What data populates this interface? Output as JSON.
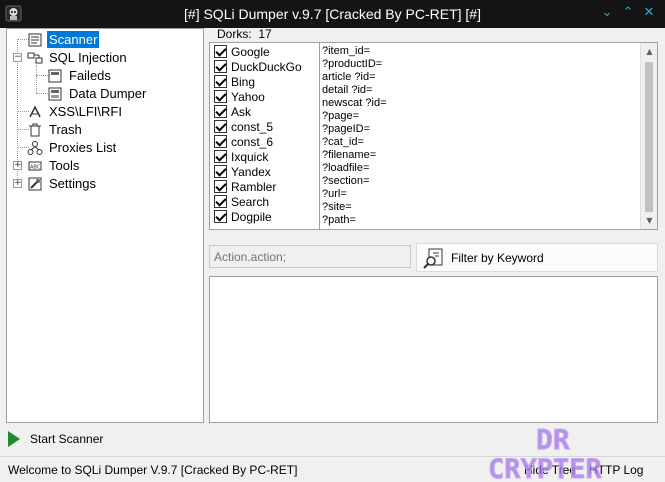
{
  "window": {
    "title": "[#] SQLi Dumper v.9.7 [Cracked By PC-RET] [#]"
  },
  "tree": [
    {
      "label": "Scanner",
      "name": "tree-item-scanner",
      "icon": "scanner-icon",
      "selected": true
    },
    {
      "label": "SQL Injection",
      "name": "tree-item-sql-injection",
      "icon": "sql-injection-icon"
    },
    {
      "label": "Faileds",
      "name": "tree-item-faileds",
      "icon": "faileds-icon"
    },
    {
      "label": "Data Dumper",
      "name": "tree-item-data-dumper",
      "icon": "data-dumper-icon"
    },
    {
      "label": "XSS\\LFI\\RFI",
      "name": "tree-item-xss-lfi-rfi",
      "icon": "xss-icon"
    },
    {
      "label": "Trash",
      "name": "tree-item-trash",
      "icon": "trash-icon"
    },
    {
      "label": "Proxies List",
      "name": "tree-item-proxies-list",
      "icon": "proxies-icon"
    },
    {
      "label": "Tools",
      "name": "tree-item-tools",
      "icon": "tools-icon"
    },
    {
      "label": "Settings",
      "name": "tree-item-settings",
      "icon": "settings-icon"
    }
  ],
  "dorks": {
    "label": "Dorks:",
    "count": "17",
    "engines": [
      {
        "label": "Google",
        "checked": true
      },
      {
        "label": "DuckDuckGo",
        "checked": true
      },
      {
        "label": "Bing",
        "checked": true
      },
      {
        "label": "Yahoo",
        "checked": true
      },
      {
        "label": "Ask",
        "checked": true
      },
      {
        "label": "const_5",
        "checked": true
      },
      {
        "label": "const_6",
        "checked": true
      },
      {
        "label": "Ixquick",
        "checked": true
      },
      {
        "label": "Yandex",
        "checked": true
      },
      {
        "label": "Rambler",
        "checked": true
      },
      {
        "label": "Search",
        "checked": true
      },
      {
        "label": "Dogpile",
        "checked": true
      }
    ],
    "items": [
      "?item_id=",
      "?productID=",
      "article ?id=",
      "detail ?id=",
      "newscat ?id=",
      "?page=",
      "?pageID=",
      "?cat_id=",
      "?filename=",
      "?loadfile=",
      "?section=",
      "?url=",
      "?site=",
      "?path="
    ]
  },
  "filter": {
    "placeholder": "Action.action;",
    "button_label": "Filter by Keyword"
  },
  "actions": {
    "start_label": "Start Scanner"
  },
  "status": {
    "text": "Welcome to SQLi Dumper V.9.7 [Cracked By PC-RET]",
    "hide_tree": "Hide Tree",
    "http_log": "HTTP Log"
  },
  "watermark": {
    "line1": "DR",
    "line2": "CRYPTER"
  },
  "colors": {
    "titlebar": "#141414",
    "accent": "#0078d7",
    "start_icon": "#1f8a2e",
    "watermark": "#a470e8"
  }
}
